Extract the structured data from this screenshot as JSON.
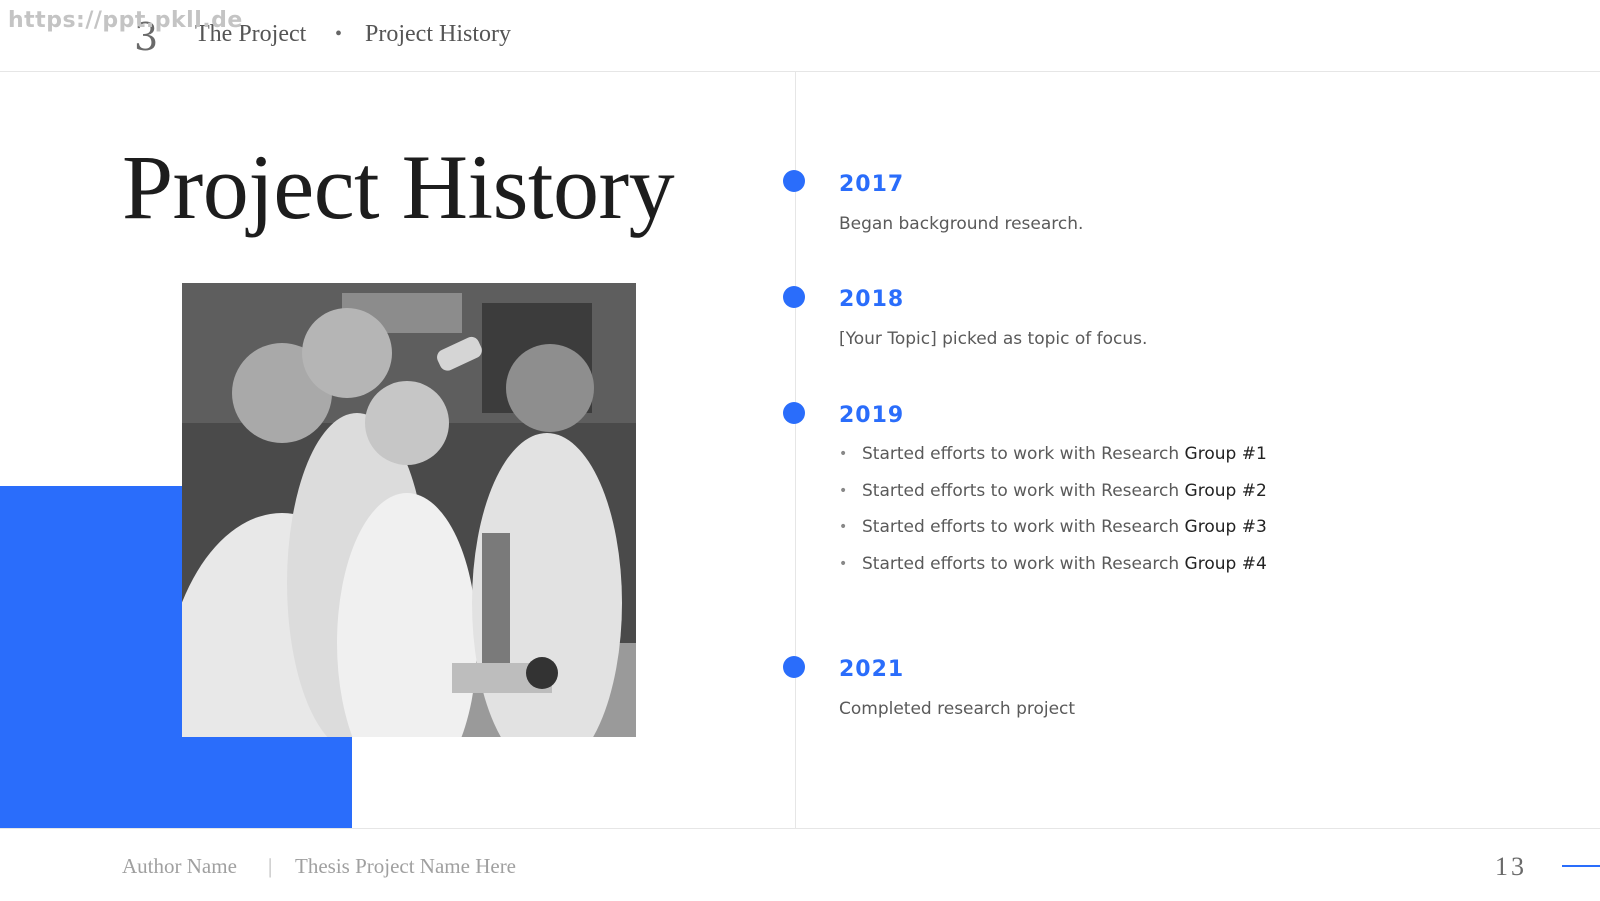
{
  "watermark": "https://ppt.pkll.de",
  "header": {
    "section_number": "3",
    "breadcrumb_section": "The Project",
    "breadcrumb_separator": "•",
    "breadcrumb_page": "Project History"
  },
  "title": "Project History",
  "photo": {
    "icon": "lab-scientists-photo"
  },
  "timeline": [
    {
      "year": "2017",
      "text": "Began background research."
    },
    {
      "year": "2018",
      "text": "[Your Topic] picked as topic of focus."
    },
    {
      "year": "2019",
      "bullets": [
        {
          "prefix": "Started efforts to work with Research ",
          "suffix": "Group #1"
        },
        {
          "prefix": "Started efforts to work with Research ",
          "suffix": "Group #2"
        },
        {
          "prefix": "Started efforts to work with Research ",
          "suffix": "Group #3"
        },
        {
          "prefix": "Started efforts to work with Research ",
          "suffix": "Group #4"
        }
      ]
    },
    {
      "year": "2021",
      "text": "Completed research project"
    }
  ],
  "bullet_glyph": "•",
  "footer": {
    "author": "Author Name",
    "separator": "|",
    "project": "Thesis Project Name Here",
    "page_number": "13"
  },
  "colors": {
    "accent": "#2a6dfb",
    "title": "#1d1d1d",
    "body_text": "#5a5a5a"
  }
}
